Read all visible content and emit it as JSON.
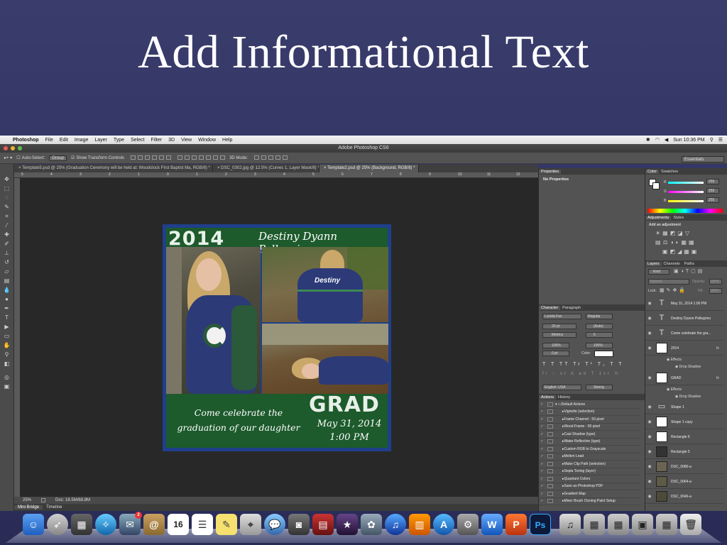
{
  "slide": {
    "title": "Add Informational Text"
  },
  "menubar": {
    "app": "Photoshop",
    "items": [
      "File",
      "Edit",
      "Image",
      "Layer",
      "Type",
      "Select",
      "Filter",
      "3D",
      "View",
      "Window",
      "Help"
    ],
    "clock": "Sun 10:36 PM"
  },
  "window": {
    "title": "Adobe Photoshop CS6"
  },
  "options": {
    "auto_select_label": "Auto-Select:",
    "auto_select_value": "Group",
    "show_transform": "Show Transform Controls",
    "mode_3d": "3D Mode:",
    "workspace": "Essentials"
  },
  "doc_tabs": [
    {
      "label": "Template5.psd @ 25% (Graduation Ceremony will be held at: Woodstock First Baptist Ma, RGB/8) *"
    },
    {
      "label": "DSC_0302.jpg @ 12.5% (Curves 1, Layer Mask/8) *"
    },
    {
      "label": "Template2.psd @ 25% (Background, RGB/8) *"
    }
  ],
  "ruler_ticks": [
    "5",
    "4",
    "3",
    "2",
    "1",
    "0",
    "1",
    "2",
    "3",
    "4",
    "5",
    "6",
    "7",
    "8",
    "9",
    "10",
    "11",
    "12"
  ],
  "status": {
    "zoom": "25%",
    "doc": "Doc: 16.5M/68.8M"
  },
  "bottom_tabs": [
    "Mini Bridge",
    "Timeline"
  ],
  "poster": {
    "year": "2014",
    "name": "Destiny Dyann Pellegrino",
    "grad": "GRAD",
    "celebrate_line1": "Come celebrate the",
    "celebrate_line2": "graduation of our daughter",
    "date": "May 31, 2014",
    "time": "1:00 PM",
    "jacket_text": "Destiny"
  },
  "properties": {
    "tab": "Properties",
    "content": "No Properties"
  },
  "character": {
    "tabs": [
      "Character",
      "Paragraph"
    ],
    "font": "Lucida Fax",
    "style": "Regular",
    "size": "20 pt",
    "leading": "(Auto)",
    "kerning": "Metrics",
    "tracking": "5",
    "vscale": "100%",
    "hscale": "100%",
    "baseline": "0 pt",
    "color_label": "Color:",
    "language": "English: USA",
    "aa": "Strong"
  },
  "actions": {
    "tabs": [
      "Actions",
      "History"
    ],
    "set": "Default Actions",
    "items": [
      "Vignette (selection)",
      "Frame Channel - 50 pixel",
      "Wood Frame - 50 pixel",
      "Cast Shadow (type)",
      "Water Reflection (type)",
      "Custom RGB to Grayscale",
      "Molten Lead",
      "Make Clip Path (selection)",
      "Sepia Toning (layer)",
      "Quadrant Colors",
      "Save as Photoshop PDF",
      "Gradient Map",
      "Mixer Brush Cloning Paint Setup"
    ]
  },
  "color": {
    "tabs": [
      "Color",
      "Swatches"
    ],
    "r": "255",
    "g": "255",
    "b": "255",
    "r_label": "R",
    "g_label": "G",
    "b_label": "B"
  },
  "adjustments": {
    "tabs": [
      "Adjustments",
      "Styles"
    ],
    "label": "Add an adjustment"
  },
  "layers": {
    "tabs": [
      "Layers",
      "Channels",
      "Paths"
    ],
    "kind": "Kind",
    "blend": "Normal",
    "opacity_label": "Opacity:",
    "opacity": "100%",
    "lock_label": "Lock:",
    "fill_label": "Fill:",
    "fill": "100%",
    "fx": "fx",
    "effects": "Effects",
    "drop_shadow": "Drop Shadow",
    "items": [
      "May 31, 2014 1:00 PM",
      "Destiny Dyann Pellegrino",
      "Come celebrate the  gra...",
      "2014",
      "GRAD",
      "Shape 1",
      "Shape 1 copy",
      "Rectangle 6",
      "Rectangle 5",
      "DSC_0080-a",
      "DSC_0064-a",
      "DSC_0046-a"
    ]
  },
  "dock": {
    "calendar_day": "16",
    "badge": "2"
  }
}
